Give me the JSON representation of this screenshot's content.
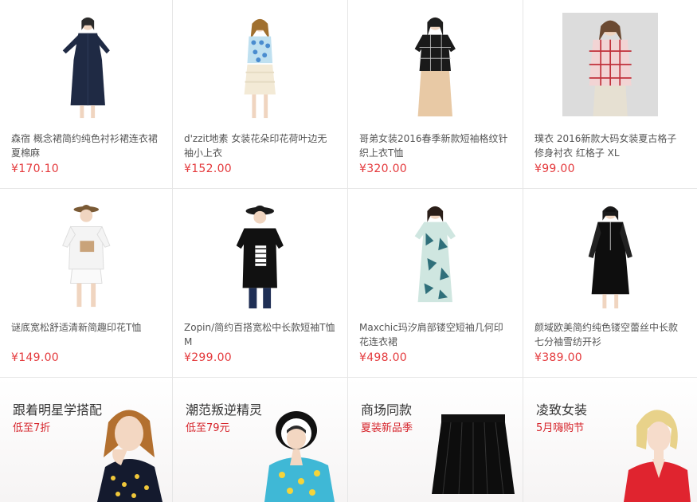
{
  "products": [
    {
      "name": "森宿 概念裙简约纯色衬衫裙连衣裙夏棉麻",
      "price": "¥170.10",
      "image": "model-navy-shirt-dress"
    },
    {
      "name": "d'zzit地素 女装花朵印花荷叶边无袖小上衣",
      "price": "¥152.00",
      "image": "model-floral-sleeveless-top"
    },
    {
      "name": "哥弟女装2016春季新款短袖格纹针织上衣T恤",
      "price": "¥320.00",
      "image": "model-black-check-knit-top"
    },
    {
      "name": "璞衣 2016新款大码女装夏古格子修身衬衣 红格子 XL",
      "price": "¥99.00",
      "image": "model-red-plaid-shirt"
    },
    {
      "name": "谜底宽松舒适清新简趣印花T恤",
      "price": "¥149.00",
      "image": "model-white-print-tee"
    },
    {
      "name": "Zopin/简约百搭宽松中长款短袖T恤M",
      "price": "¥299.00",
      "image": "model-black-print-tee"
    },
    {
      "name": "Maxchic玛汐肩部镂空短袖几何印花连衣裙",
      "price": "¥498.00",
      "image": "model-geometric-print-dress"
    },
    {
      "name": "颜域欧美简约纯色镂空蕾丝中长款七分袖雪纺开衫",
      "price": "¥389.00",
      "image": "model-black-chiffon-cardigan"
    }
  ],
  "promos": [
    {
      "title": "跟着明星学搭配",
      "subtitle": "低至7折",
      "image": "model-polka-dot-top"
    },
    {
      "title": "潮范叛逆精灵",
      "subtitle": "低至79元",
      "image": "model-hat-colorful-shirt"
    },
    {
      "title": "商场同款",
      "subtitle": "夏装新品季",
      "image": "black-pleated-skirt"
    },
    {
      "title": "凌致女装",
      "subtitle": "5月嗨购节",
      "image": "model-red-blouse"
    }
  ],
  "colors": {
    "price": "#e4393c",
    "promo_subtitle": "#d6242b",
    "border": "#e6e6e6"
  }
}
